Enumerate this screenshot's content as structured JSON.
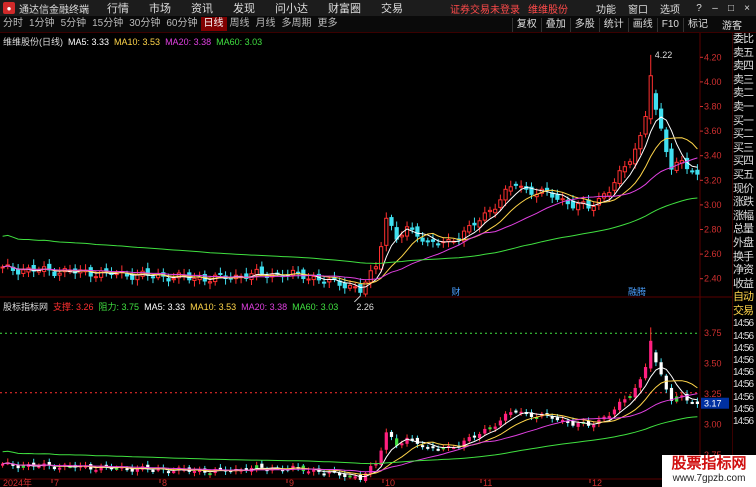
{
  "titlebar": {
    "app_title": "通达信金融终端",
    "menu": [
      "行情",
      "市场",
      "资讯",
      "发现",
      "问小达",
      "财富圈",
      "交易"
    ],
    "warn": "证券交易未登录",
    "stock_link": "维维股份",
    "links": [
      "功能",
      "窗口",
      "选项"
    ],
    "controls": [
      "?",
      "–",
      "□",
      "×"
    ]
  },
  "toolbar": {
    "periods": [
      "分时",
      "1分钟",
      "5分钟",
      "15分钟",
      "30分钟",
      "60分钟",
      "日线",
      "周线",
      "月线",
      "多周期",
      "更多"
    ],
    "active_period": "日线",
    "tools": [
      "复权",
      "叠加",
      "多股",
      "统计",
      "画线",
      "F10",
      "标记"
    ],
    "user": "游客"
  },
  "main_legend": {
    "title": "维维股份(日线)",
    "items": [
      {
        "label": "MA5: 3.33",
        "color": "#ffffff"
      },
      {
        "label": "MA10: 3.53",
        "color": "#ffd54a"
      },
      {
        "label": "MA20: 3.38",
        "color": "#e040e0"
      },
      {
        "label": "MA60: 3.03",
        "color": "#40e040"
      }
    ]
  },
  "sub_legend": {
    "title": "股标指标网",
    "items": [
      {
        "label": "支撑: 3.26",
        "color": "#ff3030"
      },
      {
        "label": "阻力: 3.75",
        "color": "#40e040"
      },
      {
        "label": "MA5: 3.33",
        "color": "#ffffff"
      },
      {
        "label": "MA10: 3.53",
        "color": "#ffd54a"
      },
      {
        "label": "MA20: 3.38",
        "color": "#e040e0"
      },
      {
        "label": "MA60: 3.03",
        "color": "#40e040"
      }
    ]
  },
  "main_axis": [
    "4.20",
    "4.00",
    "3.80",
    "3.60",
    "3.40",
    "3.20",
    "3.00",
    "2.80",
    "2.60",
    "2.40"
  ],
  "sub_axis": [
    "3.75",
    "3.50",
    "3.25",
    "3.00",
    "2.75"
  ],
  "sub_cur_label": "3.17",
  "annotations": {
    "high": "4.22",
    "low": "2.26"
  },
  "events": {
    "cai": "财",
    "rong": "融腾"
  },
  "date_axis": {
    "year": "2024年",
    "months": [
      "7",
      "8",
      "9",
      "10",
      "11",
      "12"
    ]
  },
  "sidebar": {
    "rows": [
      "委比",
      "卖五",
      "卖四",
      "卖三",
      "卖二",
      "卖一",
      "买一",
      "买二",
      "买三",
      "买四",
      "买五"
    ],
    "rows2": [
      "现价",
      "涨跌",
      "涨幅",
      "总量",
      "外盘",
      "换手",
      "净资",
      "收益"
    ],
    "rows3": [
      "自动",
      "交易"
    ],
    "times": [
      "14:56",
      "14:56",
      "14:56",
      "14:56",
      "14:56",
      "14:56",
      "14:56",
      "14:56",
      "14:56"
    ]
  },
  "watermark": {
    "line1": "股票指标网",
    "line2": "www.7gpzb.com"
  },
  "colors": {
    "up": "#ff3030",
    "down": "#40e0f0",
    "ma5": "#ffffff",
    "ma10": "#ffd54a",
    "ma20": "#e040e0",
    "ma60": "#40e040",
    "axis": "#d03030"
  }
}
